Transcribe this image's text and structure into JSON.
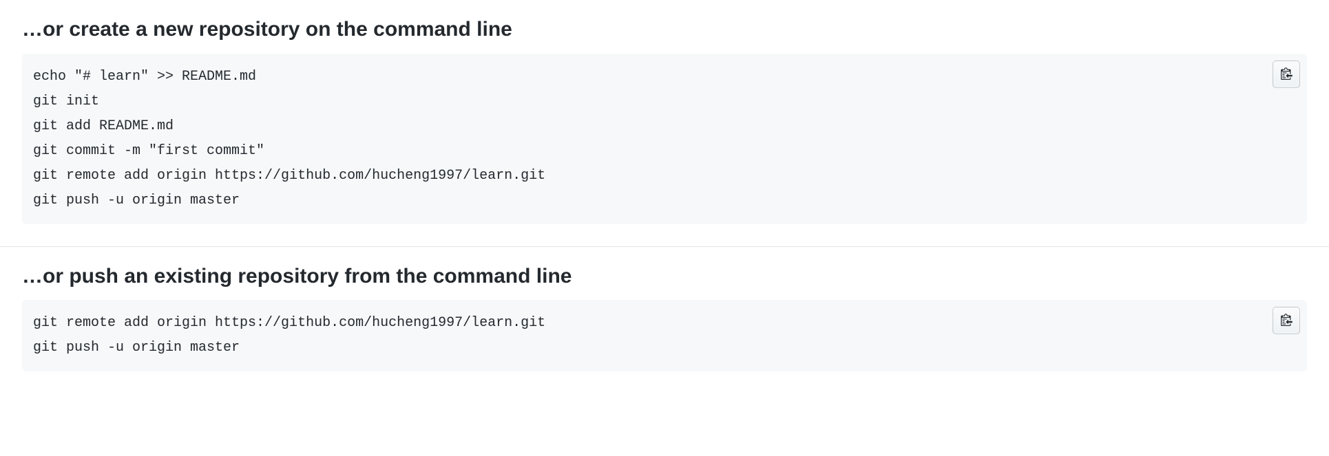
{
  "sections": [
    {
      "heading": "…or create a new repository on the command line",
      "code": "echo \"# learn\" >> README.md\ngit init\ngit add README.md\ngit commit -m \"first commit\"\ngit remote add origin https://github.com/hucheng1997/learn.git\ngit push -u origin master"
    },
    {
      "heading": "…or push an existing repository from the command line",
      "code": "git remote add origin https://github.com/hucheng1997/learn.git\ngit push -u origin master"
    }
  ]
}
